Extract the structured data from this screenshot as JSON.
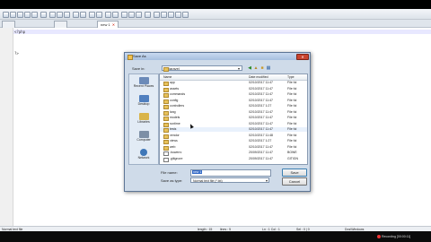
{
  "editor": {
    "tabs": [
      {
        "label": "",
        "active": false
      },
      {
        "label": "",
        "active": false
      },
      {
        "label": "new 1",
        "active": true
      }
    ],
    "code_lines": [
      "<?php",
      "?>"
    ]
  },
  "status": {
    "left": "Normal text file",
    "length": "length : 15",
    "lines": "lines : 5",
    "ln_col": "Ln : 1   Col : 1",
    "sel": "Sel : 0 | 0",
    "eol": "Dos\\Windows",
    "recording": "Recording [00:00:11]"
  },
  "dialog": {
    "title": "Save As",
    "close_label": "✕",
    "save_in_label": "Save in:",
    "save_in_value": "laravel",
    "places": [
      "Recent Places",
      "Desktop",
      "Libraries",
      "Computer",
      "Network"
    ],
    "columns": [
      "Name",
      "Date modified",
      "Type"
    ],
    "rows": [
      {
        "name": "app",
        "date": "02/10/2017 11:47",
        "type": "File fol",
        "kind": "folder"
      },
      {
        "name": "assets",
        "date": "02/10/2017 11:47",
        "type": "File fol",
        "kind": "folder"
      },
      {
        "name": "commands",
        "date": "02/10/2017 11:47",
        "type": "File fol",
        "kind": "folder"
      },
      {
        "name": "config",
        "date": "02/10/2017 11:47",
        "type": "File fol",
        "kind": "folder"
      },
      {
        "name": "controllers",
        "date": "02/10/2017 1:27",
        "type": "File fol",
        "kind": "folder"
      },
      {
        "name": "lang",
        "date": "02/10/2017 11:47",
        "type": "File fol",
        "kind": "folder"
      },
      {
        "name": "models",
        "date": "02/10/2017 11:47",
        "type": "File fol",
        "kind": "folder"
      },
      {
        "name": "runtime",
        "date": "02/10/2017 11:47",
        "type": "File fol",
        "kind": "folder"
      },
      {
        "name": "tests",
        "date": "02/10/2017 11:47",
        "type": "File fol",
        "kind": "folder"
      },
      {
        "name": "vendor",
        "date": "02/10/2017 11:48",
        "type": "File fol",
        "kind": "folder"
      },
      {
        "name": "views",
        "date": "02/10/2017 1:27",
        "type": "File fol",
        "kind": "folder"
      },
      {
        "name": "web",
        "date": "02/10/2017 11:47",
        "type": "File fol",
        "kind": "folder"
      },
      {
        "name": ".bowerrc",
        "date": "20/09/2017 11:47",
        "type": "BOWE",
        "kind": "file"
      },
      {
        "name": ".gitignore",
        "date": "20/09/2017 11:47",
        "type": "GITIGN",
        "kind": "file"
      }
    ],
    "file_name_label": "File name:",
    "file_name_value": "new 1",
    "save_type_label": "Save as type:",
    "save_type_value": "Normal text file (*.txt)",
    "save_button": "Save",
    "cancel_button": "Cancel"
  }
}
